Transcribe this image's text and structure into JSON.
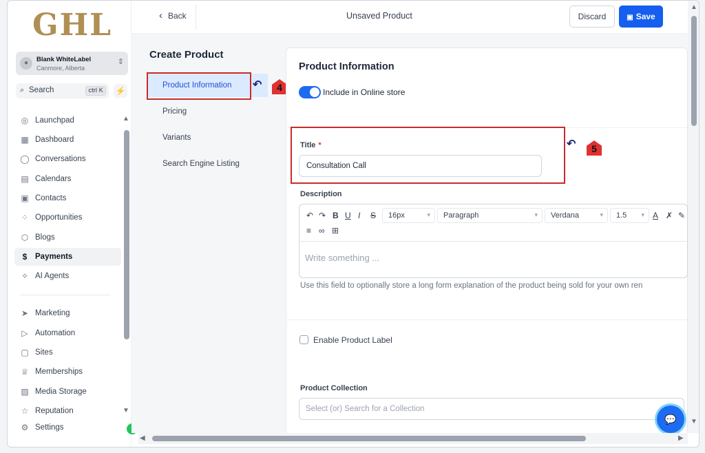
{
  "sidebar": {
    "logo": "GHL",
    "account": {
      "name": "Blank WhiteLabel",
      "location": "Canmore, Alberta"
    },
    "search": {
      "label": "Search",
      "shortcut": "ctrl K"
    },
    "items": [
      {
        "label": "Launchpad",
        "icon": "◎"
      },
      {
        "label": "Dashboard",
        "icon": "▦"
      },
      {
        "label": "Conversations",
        "icon": "◯"
      },
      {
        "label": "Calendars",
        "icon": "▤"
      },
      {
        "label": "Contacts",
        "icon": "▣"
      },
      {
        "label": "Opportunities",
        "icon": "⁘"
      },
      {
        "label": "Blogs",
        "icon": "⬡"
      },
      {
        "label": "Payments",
        "icon": "$"
      },
      {
        "label": "AI Agents",
        "icon": "✧"
      },
      {
        "label": "Marketing",
        "icon": "➤"
      },
      {
        "label": "Automation",
        "icon": "▷"
      },
      {
        "label": "Sites",
        "icon": "▢"
      },
      {
        "label": "Memberships",
        "icon": "♕"
      },
      {
        "label": "Media Storage",
        "icon": "▨"
      },
      {
        "label": "Reputation",
        "icon": "☆"
      },
      {
        "label": "Settings",
        "icon": "⚙"
      }
    ]
  },
  "topbar": {
    "back": "Back",
    "title": "Unsaved Product",
    "discard": "Discard",
    "save": "Save"
  },
  "section_nav": {
    "title": "Create Product",
    "items": [
      "Product Information",
      "Pricing",
      "Variants",
      "Search Engine Listing"
    ]
  },
  "annotations": [
    "4",
    "5"
  ],
  "form": {
    "heading": "Product Information",
    "online_store_label": "Include in Online store",
    "title_label": "Title",
    "title_required": "*",
    "title_value": "Consultation Call",
    "description_label": "Description",
    "font_size": "16px",
    "block_type": "Paragraph",
    "font_family": "Verdana",
    "line_height": "1.5",
    "editor_placeholder": "Write something ...",
    "help_text": "Use this field to optionally store a long form explanation of the product being sold for your own ren",
    "product_label_checkbox": "Enable Product Label",
    "collection_label": "Product Collection",
    "collection_placeholder": "Select (or) Search for a Collection"
  },
  "colors": {
    "primary": "#155eef",
    "annotation_red": "#c92a2a",
    "active_nav_bg": "#dbeafe"
  }
}
